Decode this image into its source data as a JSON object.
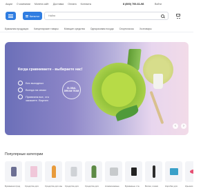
{
  "topbar": {
    "links": [
      "Акции",
      "О компании",
      "Монета сайт",
      "Доставка",
      "Оплата",
      "Контакты"
    ],
    "phone": "8 (800) 700-61-98",
    "lang": "Войти"
  },
  "header": {
    "catalog_label": "Каталог",
    "search_placeholder": "Найти"
  },
  "nav": {
    "items": [
      "Бумажная продукция",
      "Канцелярские товары",
      "Моющие средства",
      "Одноразовая посуда",
      "Спортклассы",
      "Хозтовары"
    ]
  },
  "banner": {
    "headline": "Когда сравниваете - выбираете нас!",
    "features": [
      "Без выходных",
      "Всегда на связи",
      "Привезем все, что закажете. Ворнен"
    ],
    "badge": "GLOBAL DREAM TEAM"
  },
  "categories": {
    "title": "Популярные категории",
    "items": [
      {
        "label": "Бумажная прод",
        "color": "#6c6f93"
      },
      {
        "label": "Средства для",
        "color": "#f0c7d9"
      },
      {
        "label": "Средства для мытья",
        "color": "#e89b3c"
      },
      {
        "label": "Средства для",
        "color": "#cfd2d6"
      },
      {
        "label": "Средства для",
        "color": "#5d8a45"
      },
      {
        "label": "Алюминиевые",
        "color": "#c7cacc"
      },
      {
        "label": "Бумажные ста",
        "color": "#222222"
      },
      {
        "label": "Вилки, ложки",
        "color": "#2c2c2c"
      },
      {
        "label": "Коробки для",
        "color": "#3aa0c8"
      },
      {
        "label": "Крышки для стака",
        "color": "#e64f73"
      }
    ]
  },
  "colors": {
    "accent": "#2f7de1"
  }
}
